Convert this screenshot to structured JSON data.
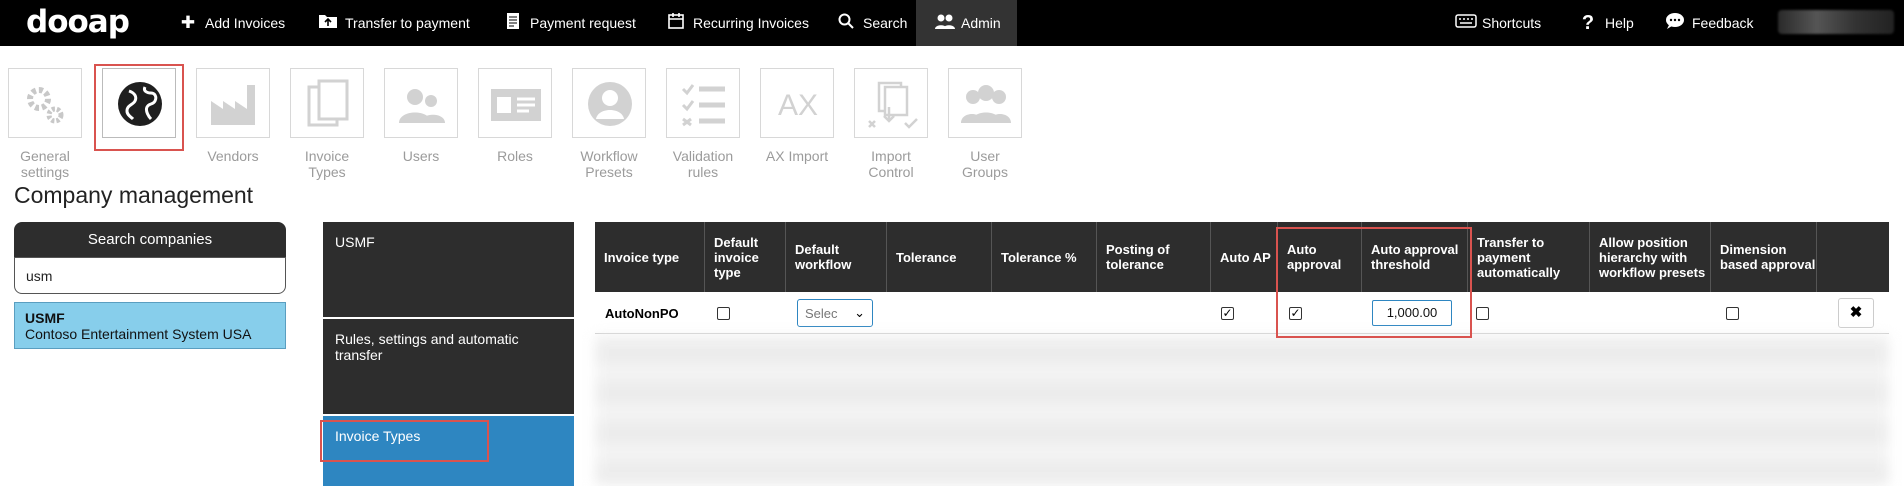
{
  "app": {
    "logo": "dooap"
  },
  "topnav": {
    "add_invoices": "Add Invoices",
    "transfer_to_payment": "Transfer to payment",
    "payment_request": "Payment request",
    "recurring_invoices": "Recurring Invoices",
    "search": "Search",
    "admin": "Admin",
    "shortcuts": "Shortcuts",
    "help": "Help",
    "feedback": "Feedback"
  },
  "admin_tiles": [
    {
      "label": "General settings",
      "icon": "gears-icon"
    },
    {
      "label": "",
      "icon": "globe-icon"
    },
    {
      "label": "Vendors",
      "icon": "factory-icon"
    },
    {
      "label": "Invoice Types",
      "icon": "documents-icon"
    },
    {
      "label": "Users",
      "icon": "users-icon"
    },
    {
      "label": "Roles",
      "icon": "id-card-icon"
    },
    {
      "label": "Workflow Presets",
      "icon": "user-circle-icon"
    },
    {
      "label": "Validation rules",
      "icon": "checklist-icon"
    },
    {
      "label": "AX Import",
      "icon": "ax-icon"
    },
    {
      "label": "Import Control",
      "icon": "import-docs-icon"
    },
    {
      "label": "User Groups",
      "icon": "user-group-icon"
    }
  ],
  "tile_labels": {
    "general_1": "General",
    "general_2": "settings",
    "vendors": "Vendors",
    "invoice_1": "Invoice",
    "invoice_2": "Types",
    "users": "Users",
    "roles": "Roles",
    "workflow_1": "Workflow",
    "workflow_2": "Presets",
    "validation_1": "Validation",
    "validation_2": "rules",
    "ax_import": "AX Import",
    "import_1": "Import",
    "import_2": "Control",
    "groups_1": "User",
    "groups_2": "Groups"
  },
  "page_title": "Company management",
  "companies": {
    "search_title": "Search companies",
    "search_value": "usm",
    "selected": {
      "code": "USMF",
      "name": "Contoso Entertainment System USA"
    }
  },
  "menu": {
    "company": "USMF",
    "rules": "Rules, settings and automatic transfer",
    "invoice_types": "Invoice Types"
  },
  "table": {
    "headers": {
      "invoice_type": "Invoice type",
      "default_invoice_type": "Default invoice type",
      "default_workflow": "Default workflow",
      "tolerance": "Tolerance",
      "tolerance_pct": "Tolerance %",
      "posting_of_tolerance": "Posting of tolerance",
      "auto_ap": "Auto AP",
      "auto_approval": "Auto approval",
      "auto_approval_threshold": "Auto approval threshold",
      "transfer_to_payment": "Transfer to payment automatically",
      "allow_position": "Allow position hierarchy with workflow presets",
      "dimension_based": "Dimension based approval"
    },
    "row": {
      "invoice_type": "AutoNonPO",
      "default_workflow": "Selec",
      "threshold": "1,000.00",
      "auto_ap_check": "✓",
      "auto_approval_check": "✓",
      "delete": "✖"
    }
  },
  "colors": {
    "accent": "#2e86c1",
    "highlight": "#d9534f",
    "topbar": "#000000",
    "panel": "#2d2d2d"
  }
}
